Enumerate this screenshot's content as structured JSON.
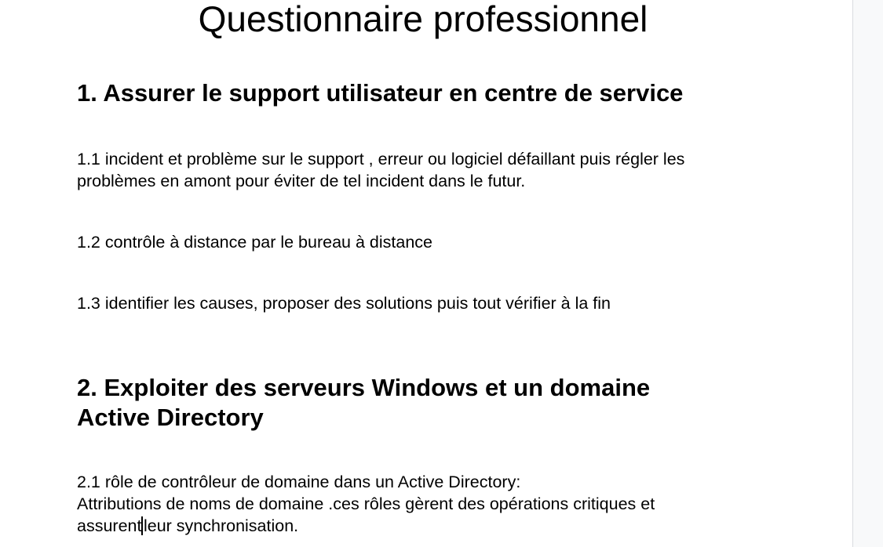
{
  "document": {
    "title": "Questionnaire professionnel",
    "section1": {
      "heading": "1. Assurer le support utilisateur en centre de service",
      "p1_line1": "1.1 incident et problème sur le support , erreur ou logiciel défaillant puis régler les",
      "p1_line2": "problèmes en amont pour éviter de tel incident  dans le futur.",
      "p2": "1.2 contrôle à distance par le bureau à distance",
      "p3": "1.3 identifier les causes, proposer des solutions puis tout vérifier à la fin"
    },
    "section2": {
      "heading_line1": "2. Exploiter des serveurs Windows et un domaine",
      "heading_line2": "Active Directory",
      "p1_line1": "2.1 rôle de contrôleur de domaine dans un Active Directory:",
      "p1_line2": "Attributions de noms de domaine .ces rôles gèrent des opérations critiques et",
      "p1_line3_before_cursor": "assurent",
      "p1_line3_after_cursor": "leur synchronisation."
    }
  }
}
